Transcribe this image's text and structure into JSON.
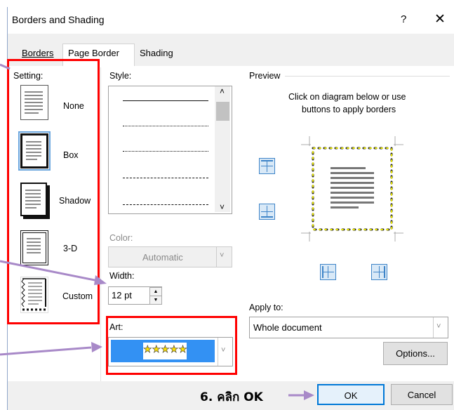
{
  "dialog": {
    "title": "Borders and Shading",
    "help": "?",
    "close": "✕"
  },
  "tabs": [
    {
      "label": "Borders"
    },
    {
      "label": "Page Border"
    },
    {
      "label": "Shading"
    }
  ],
  "setting": {
    "label": "Setting:",
    "options": [
      {
        "label": "None"
      },
      {
        "label": "Box"
      },
      {
        "label": "Shadow"
      },
      {
        "label": "3-D"
      },
      {
        "label": "Custom"
      }
    ]
  },
  "style": {
    "label": "Style:",
    "scroll_up": "˄",
    "scroll_down": "˅"
  },
  "color": {
    "label": "Color:",
    "value": "Automatic"
  },
  "width": {
    "label": "Width:",
    "value": "12 pt"
  },
  "art": {
    "label": "Art:",
    "stars": "★★★★★"
  },
  "preview": {
    "label": "Preview",
    "hint_line1": "Click on diagram below or use",
    "hint_line2": "buttons to apply borders"
  },
  "apply_to": {
    "label": "Apply to:",
    "value": "Whole document"
  },
  "buttons": {
    "options": "Options...",
    "ok": "OK",
    "cancel": "Cancel"
  },
  "annotation": {
    "step_text": "6. คลิก OK"
  },
  "colors": {
    "highlight_red": "#ff0000",
    "arrow_purple": "#a889c8",
    "art_blue": "#3391f3",
    "star_yellow": "#ffff00"
  }
}
